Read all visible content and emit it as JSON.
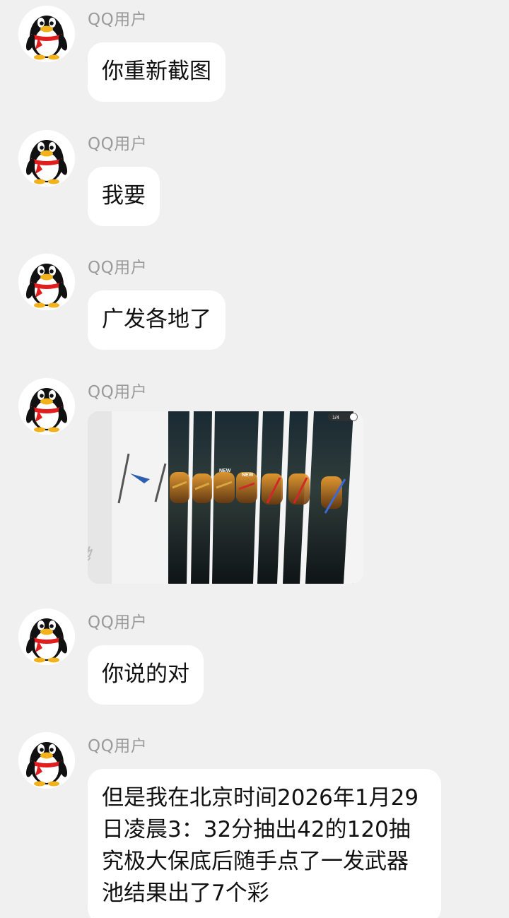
{
  "messages": [
    {
      "sender": "QQ用户",
      "text": "你重新截图"
    },
    {
      "sender": "QQ用户",
      "text": "我要"
    },
    {
      "sender": "QQ用户",
      "text": "广发各地了"
    },
    {
      "sender": "QQ用户",
      "image": {
        "description_icon": "game-screenshot-image",
        "new_badge": "NEW",
        "counter": "1/4"
      }
    },
    {
      "sender": "QQ用户",
      "text": "你说的对"
    },
    {
      "sender": "QQ用户",
      "text": "但是我在北京时间2026年1月29日凌晨3：32分抽出42的120抽究极大保底后随手点了一发武器池结果出了7个彩"
    }
  ],
  "colors": {
    "background": "#f0f0f0",
    "bubble": "#ffffff",
    "sender": "#9a9a9a",
    "text": "#111111"
  },
  "avatar_icon": "qq-penguin-avatar-icon"
}
